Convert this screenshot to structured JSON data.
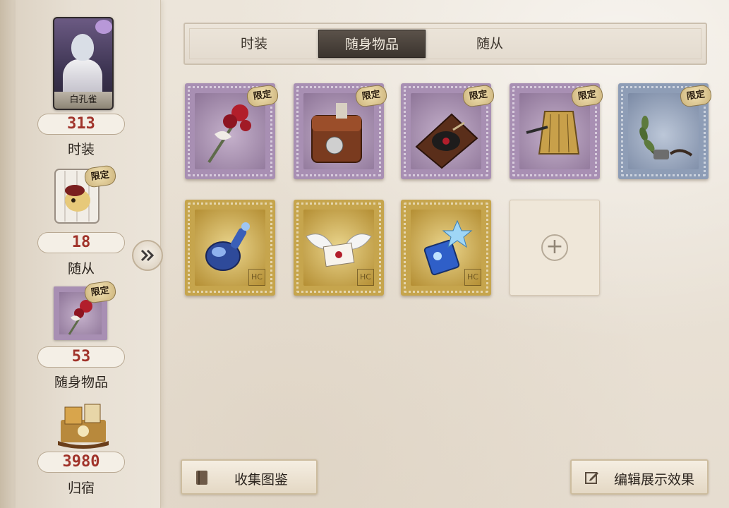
{
  "sidebar": {
    "character": {
      "name": "白孔雀"
    },
    "stats": [
      {
        "value": "313",
        "label": "时装"
      },
      {
        "value": "18",
        "label": "随从"
      },
      {
        "value": "53",
        "label": "随身物品"
      },
      {
        "value": "3980",
        "label": "归宿"
      }
    ],
    "limited_tag": "限定",
    "expand_icon": "double-chevron-right-icon"
  },
  "tabs": [
    {
      "label": "时装",
      "active": false
    },
    {
      "label": "随身物品",
      "active": true
    },
    {
      "label": "随从",
      "active": false
    }
  ],
  "items": [
    {
      "name": "rose-bouquet",
      "frame": "purple",
      "tag": "限定"
    },
    {
      "name": "leather-satchel",
      "frame": "purple",
      "tag": "限定"
    },
    {
      "name": "gramophone-book",
      "frame": "purple",
      "tag": "限定"
    },
    {
      "name": "golden-lantern",
      "frame": "purple",
      "tag": "限定"
    },
    {
      "name": "laurel-branch",
      "frame": "blue",
      "tag": "限定"
    },
    {
      "name": "blue-potion-bottle",
      "frame": "gold",
      "tag": ""
    },
    {
      "name": "winged-letter",
      "frame": "gold",
      "tag": ""
    },
    {
      "name": "star-crystal-bottle",
      "frame": "gold",
      "tag": ""
    }
  ],
  "empty_slot_icon": "plus-icon",
  "buttons": {
    "collection": "收集图鉴",
    "edit_display": "编辑展示效果"
  },
  "colors": {
    "count_text": "#a0332a",
    "active_tab": "#3b342e",
    "purple_frame": "#a88fb3",
    "gold_frame": "#c6a54d",
    "blue_frame": "#8e9db6"
  }
}
